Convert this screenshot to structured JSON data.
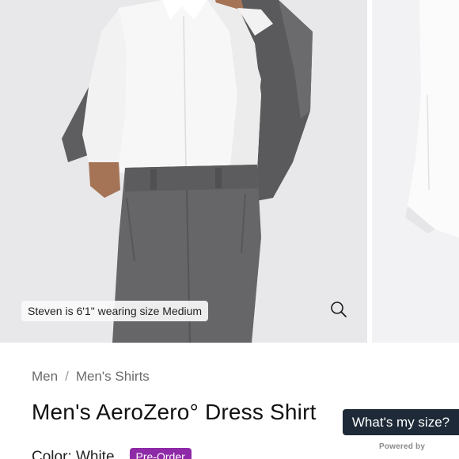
{
  "gallery": {
    "model_caption": "Steven is 6'1\" wearing size Medium",
    "zoom_icon": "magnifier-icon"
  },
  "breadcrumb": {
    "items": [
      "Men",
      "Men's Shirts"
    ],
    "separator": "/"
  },
  "product": {
    "title": "Men's AeroZero° Dress Shirt",
    "color_label": "Color: White",
    "badge": "Pre-Order"
  },
  "size_widget": {
    "button_label": "What's my size?",
    "powered_by": "Powered by"
  },
  "colors": {
    "badge_bg": "#8e2aa8",
    "size_button_bg": "#1e2a38",
    "image_bg": "#e9e9eb"
  }
}
